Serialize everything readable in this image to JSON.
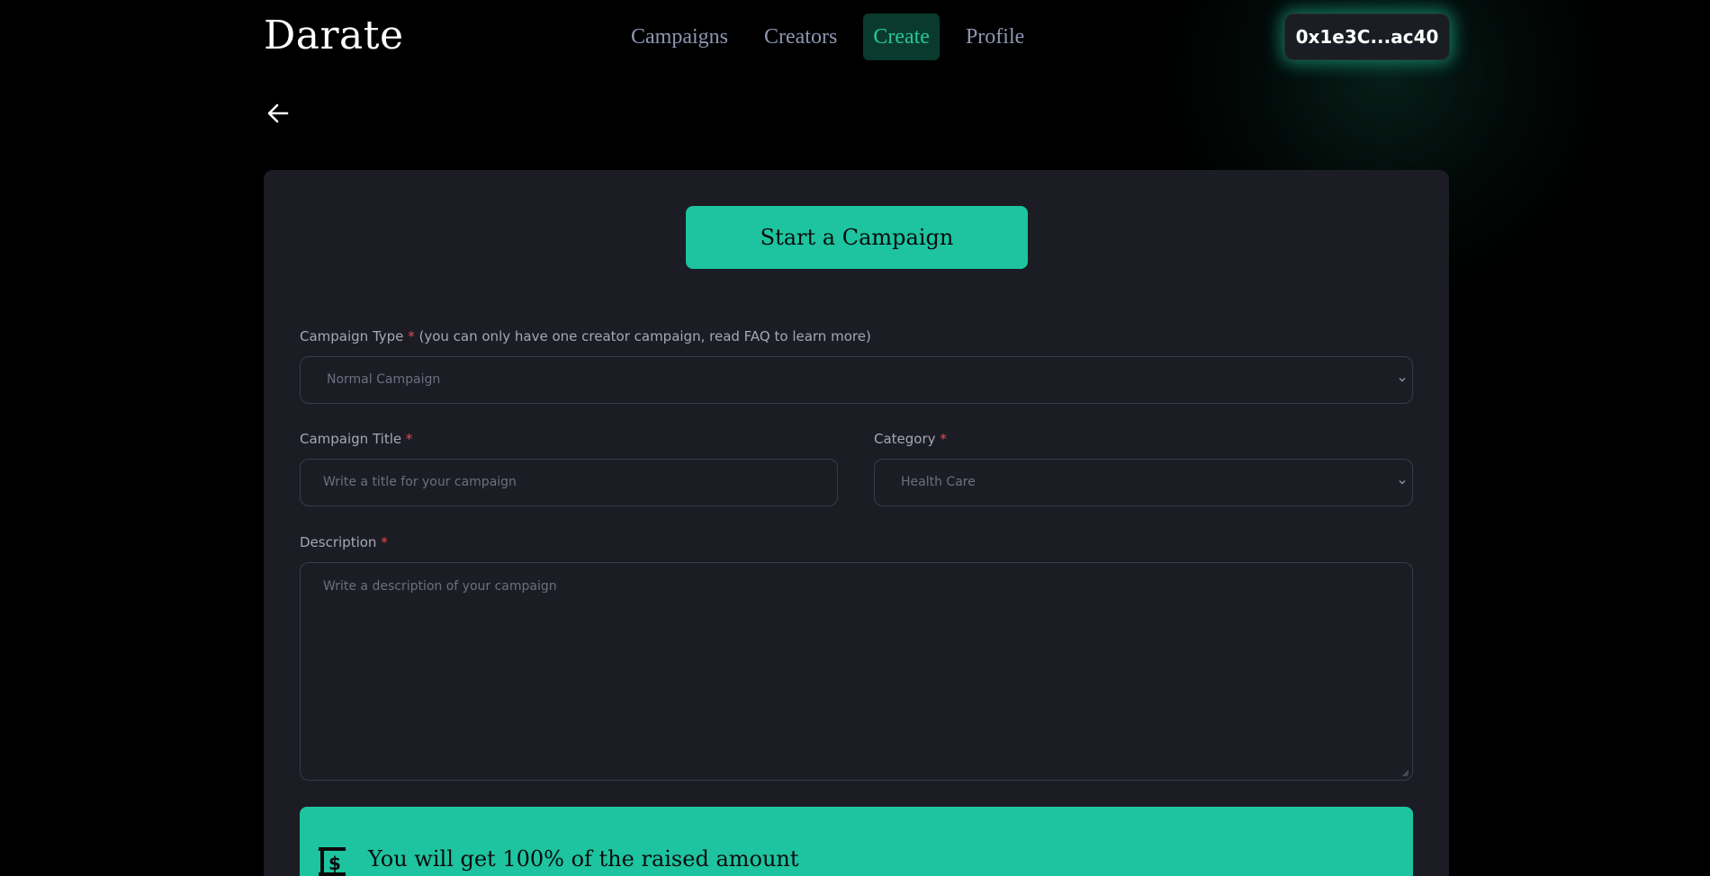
{
  "brand": {
    "logo": "Darate"
  },
  "nav": {
    "items": [
      {
        "label": "Campaigns",
        "active": false
      },
      {
        "label": "Creators",
        "active": false
      },
      {
        "label": "Create",
        "active": true
      },
      {
        "label": "Profile",
        "active": false
      }
    ]
  },
  "wallet": {
    "address": "0x1e3C...ac40"
  },
  "form": {
    "heading_button": "Start a Campaign",
    "campaign_type": {
      "label": "Campaign Type",
      "required_mark": "*",
      "note": "(you can only have one creator campaign, read FAQ to learn more)",
      "value": "Normal Campaign"
    },
    "title": {
      "label": "Campaign Title",
      "required_mark": "*",
      "placeholder": "Write a title for your campaign"
    },
    "category": {
      "label": "Category",
      "required_mark": "*",
      "value": "Health Care"
    },
    "description": {
      "label": "Description",
      "required_mark": "*",
      "placeholder": "Write a description of your campaign"
    },
    "banner": {
      "text": "You will get 100% of the raised amount"
    }
  },
  "colors": {
    "accent": "#1dc49f",
    "background": "#000000",
    "card": "#1c1c24",
    "nav_text": "#8e95b2",
    "required": "#e64a4a"
  },
  "icons": {
    "back": "arrow-left-icon",
    "chevron": "chevron-down-icon",
    "money": "money-icon"
  }
}
